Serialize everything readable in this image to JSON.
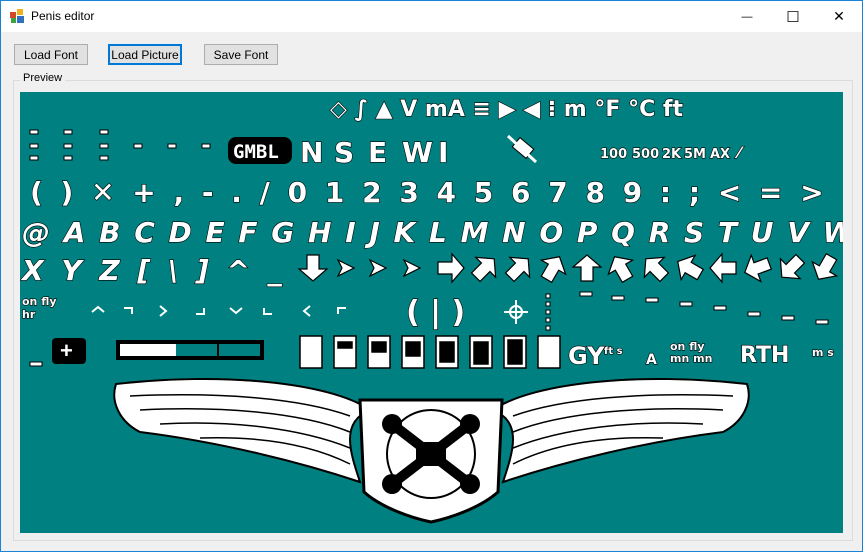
{
  "window": {
    "title": "Penis editor",
    "minimize_glyph": "—",
    "maximize_glyph": "☐",
    "close_glyph": "✕"
  },
  "toolbar": {
    "load_font_label": "Load Font",
    "load_picture_label": "Load Picture",
    "save_font_label": "Save Font"
  },
  "preview": {
    "group_label": "Preview",
    "background_color": "#008080",
    "row1_symbols": "◇ ∫ ▲ V mA ≡ ▶ ◀ ⁝ m °F °C ft",
    "row2_labels": [
      "GMBL",
      "N",
      "S",
      "E",
      "W",
      "I",
      "100",
      "500",
      "2K",
      "5M",
      "AX"
    ],
    "row3_chars": "( ) ✕ + , - . / 0 1 2 3 4 5 6 7 8 9 : ; < = >",
    "row4_chars": "@ A B C D E F G H I J K L M N O P Q R S T U V W",
    "row5_chars": "X Y Z [ \\ ] ^ _",
    "row6_labels": [
      "on fly",
      "hr"
    ],
    "row7_labels": [
      "GY",
      "ft s",
      "A",
      "on fly",
      "mn mn",
      "RTH",
      "m s"
    ]
  }
}
